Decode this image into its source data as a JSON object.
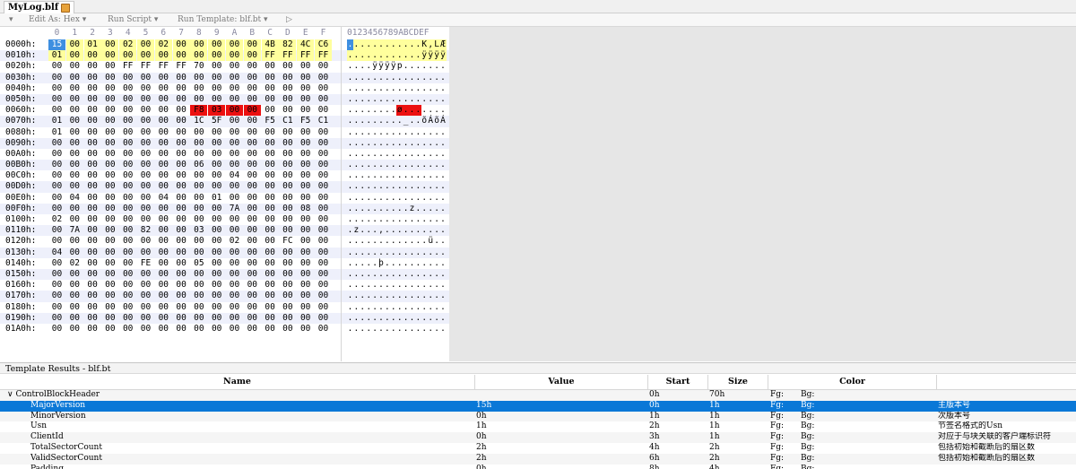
{
  "tab": {
    "filename": "MyLog.blf"
  },
  "toolbar": {
    "arrow": "▾",
    "edit_as": "Edit As: Hex ▾",
    "run_script": "Run Script ▾",
    "run_template": "Run Template: blf.bt ▾",
    "play": "▷"
  },
  "hex": {
    "columns": [
      "0",
      "1",
      "2",
      "3",
      "4",
      "5",
      "6",
      "7",
      "8",
      "9",
      "A",
      "B",
      "C",
      "D",
      "E",
      "F"
    ],
    "ascii_header": "0123456789ABCDEF",
    "rows": [
      {
        "addr": "0000h:",
        "bytes": [
          "15",
          "00",
          "01",
          "00",
          "02",
          "00",
          "02",
          "00",
          "00",
          "00",
          "00",
          "00",
          "4B",
          "82",
          "4C",
          "C6"
        ],
        "ascii": ". . . . . . . . . . . . K , L Æ"
      },
      {
        "addr": "0010h:",
        "bytes": [
          "01",
          "00",
          "00",
          "00",
          "00",
          "00",
          "00",
          "00",
          "00",
          "00",
          "00",
          "00",
          "FF",
          "FF",
          "FF",
          "FF"
        ],
        "ascii": ". . . . . . . . . . . . ÿ ÿ ÿ ÿ"
      },
      {
        "addr": "0020h:",
        "bytes": [
          "00",
          "00",
          "00",
          "00",
          "FF",
          "FF",
          "FF",
          "FF",
          "70",
          "00",
          "00",
          "00",
          "00",
          "00",
          "00",
          "00"
        ],
        "ascii": ". . . . ÿ ÿ ÿ ÿ p . . . . . . ."
      },
      {
        "addr": "0030h:",
        "bytes": [
          "00",
          "00",
          "00",
          "00",
          "00",
          "00",
          "00",
          "00",
          "00",
          "00",
          "00",
          "00",
          "00",
          "00",
          "00",
          "00"
        ],
        "ascii": ". . . . . . . . . . . . . . . ."
      },
      {
        "addr": "0040h:",
        "bytes": [
          "00",
          "00",
          "00",
          "00",
          "00",
          "00",
          "00",
          "00",
          "00",
          "00",
          "00",
          "00",
          "00",
          "00",
          "00",
          "00"
        ],
        "ascii": ". . . . . . . . . . . . . . . ."
      },
      {
        "addr": "0050h:",
        "bytes": [
          "00",
          "00",
          "00",
          "00",
          "00",
          "00",
          "00",
          "00",
          "00",
          "00",
          "00",
          "00",
          "00",
          "00",
          "00",
          "00"
        ],
        "ascii": ". . . . . . . . . . . . . . . ."
      },
      {
        "addr": "0060h:",
        "bytes": [
          "00",
          "00",
          "00",
          "00",
          "00",
          "00",
          "00",
          "00",
          "F8",
          "03",
          "00",
          "00",
          "00",
          "00",
          "00",
          "00"
        ],
        "ascii": ". . . . . . . . ø . . . . . . ."
      },
      {
        "addr": "0070h:",
        "bytes": [
          "01",
          "00",
          "00",
          "00",
          "00",
          "00",
          "00",
          "00",
          "1C",
          "5F",
          "00",
          "00",
          "F5",
          "C1",
          "F5",
          "C1"
        ],
        "ascii": ". . . . . . . . . _ . . õ Á õ Á"
      },
      {
        "addr": "0080h:",
        "bytes": [
          "01",
          "00",
          "00",
          "00",
          "00",
          "00",
          "00",
          "00",
          "00",
          "00",
          "00",
          "00",
          "00",
          "00",
          "00",
          "00"
        ],
        "ascii": ". . . . . . . . . . . . . . . ."
      },
      {
        "addr": "0090h:",
        "bytes": [
          "00",
          "00",
          "00",
          "00",
          "00",
          "00",
          "00",
          "00",
          "00",
          "00",
          "00",
          "00",
          "00",
          "00",
          "00",
          "00"
        ],
        "ascii": ". . . . . . . . . . . . . . . ."
      },
      {
        "addr": "00A0h:",
        "bytes": [
          "00",
          "00",
          "00",
          "00",
          "00",
          "00",
          "00",
          "00",
          "00",
          "00",
          "00",
          "00",
          "00",
          "00",
          "00",
          "00"
        ],
        "ascii": ". . . . . . . . . . . . . . . ."
      },
      {
        "addr": "00B0h:",
        "bytes": [
          "00",
          "00",
          "00",
          "00",
          "00",
          "00",
          "00",
          "00",
          "06",
          "00",
          "00",
          "00",
          "00",
          "00",
          "00",
          "00"
        ],
        "ascii": ". . . . . . . . . . . . . . . ."
      },
      {
        "addr": "00C0h:",
        "bytes": [
          "00",
          "00",
          "00",
          "00",
          "00",
          "00",
          "00",
          "00",
          "00",
          "00",
          "04",
          "00",
          "00",
          "00",
          "00",
          "00"
        ],
        "ascii": ". . . . . . . . . . . . . . . ."
      },
      {
        "addr": "00D0h:",
        "bytes": [
          "00",
          "00",
          "00",
          "00",
          "00",
          "00",
          "00",
          "00",
          "00",
          "00",
          "00",
          "00",
          "00",
          "00",
          "00",
          "00"
        ],
        "ascii": ". . . . . . . . . . . . . . . ."
      },
      {
        "addr": "00E0h:",
        "bytes": [
          "00",
          "04",
          "00",
          "00",
          "00",
          "00",
          "04",
          "00",
          "00",
          "01",
          "00",
          "00",
          "00",
          "00",
          "00",
          "00"
        ],
        "ascii": ". . . . . . . . . . . . . . . ."
      },
      {
        "addr": "00F0h:",
        "bytes": [
          "00",
          "00",
          "00",
          "00",
          "00",
          "00",
          "00",
          "00",
          "00",
          "00",
          "7A",
          "00",
          "00",
          "00",
          "08",
          "00"
        ],
        "ascii": ". . . . . . . . . . z . . . . ."
      },
      {
        "addr": "0100h:",
        "bytes": [
          "02",
          "00",
          "00",
          "00",
          "00",
          "00",
          "00",
          "00",
          "00",
          "00",
          "00",
          "00",
          "00",
          "00",
          "00",
          "00"
        ],
        "ascii": ". . . . . . . . . . . . . . . ."
      },
      {
        "addr": "0110h:",
        "bytes": [
          "00",
          "7A",
          "00",
          "00",
          "00",
          "82",
          "00",
          "00",
          "03",
          "00",
          "00",
          "00",
          "00",
          "00",
          "00",
          "00"
        ],
        "ascii": ". z . . . , . . . . . . . . . ."
      },
      {
        "addr": "0120h:",
        "bytes": [
          "00",
          "00",
          "00",
          "00",
          "00",
          "00",
          "00",
          "00",
          "00",
          "00",
          "02",
          "00",
          "00",
          "FC",
          "00",
          "00"
        ],
        "ascii": ". . . . . . . . . . . . . ü . ."
      },
      {
        "addr": "0130h:",
        "bytes": [
          "04",
          "00",
          "00",
          "00",
          "00",
          "00",
          "00",
          "00",
          "00",
          "00",
          "00",
          "00",
          "00",
          "00",
          "00",
          "00"
        ],
        "ascii": ". . . . . . . . . . . . . . . ."
      },
      {
        "addr": "0140h:",
        "bytes": [
          "00",
          "02",
          "00",
          "00",
          "00",
          "FE",
          "00",
          "00",
          "05",
          "00",
          "00",
          "00",
          "00",
          "00",
          "00",
          "00"
        ],
        "ascii": ". . . . . þ . . . . . . . . . ."
      },
      {
        "addr": "0150h:",
        "bytes": [
          "00",
          "00",
          "00",
          "00",
          "00",
          "00",
          "00",
          "00",
          "00",
          "00",
          "00",
          "00",
          "00",
          "00",
          "00",
          "00"
        ],
        "ascii": ". . . . . . . . . . . . . . . ."
      },
      {
        "addr": "0160h:",
        "bytes": [
          "00",
          "00",
          "00",
          "00",
          "00",
          "00",
          "00",
          "00",
          "00",
          "00",
          "00",
          "00",
          "00",
          "00",
          "00",
          "00"
        ],
        "ascii": ". . . . . . . . . . . . . . . ."
      },
      {
        "addr": "0170h:",
        "bytes": [
          "00",
          "00",
          "00",
          "00",
          "00",
          "00",
          "00",
          "00",
          "00",
          "00",
          "00",
          "00",
          "00",
          "00",
          "00",
          "00"
        ],
        "ascii": ". . . . . . . . . . . . . . . ."
      },
      {
        "addr": "0180h:",
        "bytes": [
          "00",
          "00",
          "00",
          "00",
          "00",
          "00",
          "00",
          "00",
          "00",
          "00",
          "00",
          "00",
          "00",
          "00",
          "00",
          "00"
        ],
        "ascii": ". . . . . . . . . . . . . . . ."
      },
      {
        "addr": "0190h:",
        "bytes": [
          "00",
          "00",
          "00",
          "00",
          "00",
          "00",
          "00",
          "00",
          "00",
          "00",
          "00",
          "00",
          "00",
          "00",
          "00",
          "00"
        ],
        "ascii": ". . . . . . . . . . . . . . . ."
      },
      {
        "addr": "01A0h:",
        "bytes": [
          "00",
          "00",
          "00",
          "00",
          "00",
          "00",
          "00",
          "00",
          "00",
          "00",
          "00",
          "00",
          "00",
          "00",
          "00",
          "00"
        ],
        "ascii": ". . . . . . . . . . . . . . . ."
      }
    ],
    "colors": {
      "yellow": "#ffff9d",
      "red": "#ec1010",
      "selection": "#3e8fe0"
    }
  },
  "results": {
    "title": "Template Results - blf.bt",
    "headers": {
      "name": "Name",
      "value": "Value",
      "start": "Start",
      "size": "Size",
      "color": "Color"
    },
    "rows": [
      {
        "name": "ControlBlockHeader",
        "value": "",
        "start": "0h",
        "size": "70h",
        "fg": "Fg:",
        "bg": "Bg:",
        "comment": "",
        "indent": 0,
        "expander": "∨"
      },
      {
        "name": "MajorVersion",
        "value": "15h",
        "start": "0h",
        "size": "1h",
        "fg": "Fg:",
        "bg": "Bg:",
        "comment": "主版本号",
        "indent": 1,
        "expander": ""
      },
      {
        "name": "MinorVersion",
        "value": "0h",
        "start": "1h",
        "size": "1h",
        "fg": "Fg:",
        "bg": "Bg:",
        "comment": "次版本号",
        "indent": 1,
        "expander": ""
      },
      {
        "name": "Usn",
        "value": "1h",
        "start": "2h",
        "size": "1h",
        "fg": "Fg:",
        "bg": "Bg:",
        "comment": "节签名格式的Usn",
        "indent": 1,
        "expander": ""
      },
      {
        "name": "ClientId",
        "value": "0h",
        "start": "3h",
        "size": "1h",
        "fg": "Fg:",
        "bg": "Bg:",
        "comment": "对应于与块关联的客户端标识符",
        "indent": 1,
        "expander": ""
      },
      {
        "name": "TotalSectorCount",
        "value": "2h",
        "start": "4h",
        "size": "2h",
        "fg": "Fg:",
        "bg": "Bg:",
        "comment": "包括初始和截断后的扇区数",
        "indent": 1,
        "expander": ""
      },
      {
        "name": "ValidSectorCount",
        "value": "2h",
        "start": "6h",
        "size": "2h",
        "fg": "Fg:",
        "bg": "Bg:",
        "comment": "包括初始和截断后的扇区数",
        "indent": 1,
        "expander": ""
      },
      {
        "name": "Padding",
        "value": "0h",
        "start": "8h",
        "size": "4h",
        "fg": "Fg:",
        "bg": "Bg:",
        "comment": "",
        "indent": 1,
        "expander": ""
      }
    ]
  }
}
